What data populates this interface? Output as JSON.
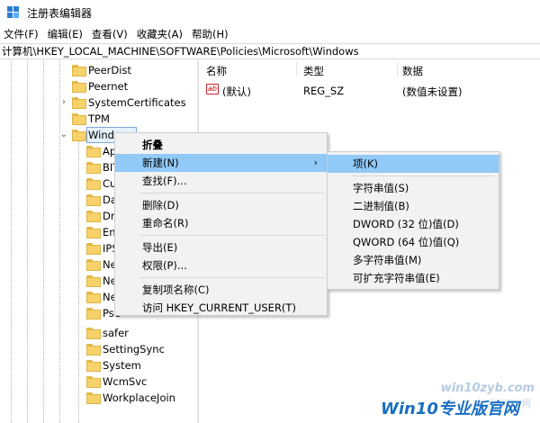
{
  "window": {
    "title": "注册表编辑器"
  },
  "menubar": [
    {
      "label": "文件(F)"
    },
    {
      "label": "编辑(E)"
    },
    {
      "label": "查看(V)"
    },
    {
      "label": "收藏夹(A)"
    },
    {
      "label": "帮助(H)"
    }
  ],
  "address": {
    "path": "计算机\\HKEY_LOCAL_MACHINE\\SOFTWARE\\Policies\\Microsoft\\Windows"
  },
  "tree": {
    "items": [
      {
        "label": "PeerDist",
        "expander": ""
      },
      {
        "label": "Peernet",
        "expander": ""
      },
      {
        "label": "SystemCertificates",
        "expander": "›"
      },
      {
        "label": "TPM",
        "expander": ""
      },
      {
        "label": "Windows",
        "expander": "⌄"
      },
      {
        "label": "Ap",
        "expander": ""
      },
      {
        "label": "BIT",
        "expander": ""
      },
      {
        "label": "Cu",
        "expander": ""
      },
      {
        "label": "Da",
        "expander": ""
      },
      {
        "label": "Dri",
        "expander": ""
      },
      {
        "label": "En",
        "expander": ""
      },
      {
        "label": "IPS",
        "expander": ""
      },
      {
        "label": "Ne",
        "expander": ""
      },
      {
        "label": "Ne",
        "expander": ""
      },
      {
        "label": "Ne",
        "expander": ""
      },
      {
        "label": "Pse",
        "expander": ""
      },
      {
        "label": "safer",
        "expander": ""
      },
      {
        "label": "SettingSync",
        "expander": ""
      },
      {
        "label": "System",
        "expander": ""
      },
      {
        "label": "WcmSvc",
        "expander": ""
      },
      {
        "label": "WorkplaceJoin",
        "expander": ""
      }
    ]
  },
  "list": {
    "headers": {
      "name": "名称",
      "type": "类型",
      "data": "数据"
    },
    "rows": [
      {
        "icon": "ab",
        "name": "(默认)",
        "type": "REG_SZ",
        "data": "(数值未设置)"
      }
    ]
  },
  "context_menu": {
    "items": [
      {
        "label": "折叠",
        "bold": true
      },
      {
        "label": "新建(N)",
        "submenu": "›"
      },
      {
        "label": "查找(F)..."
      },
      {
        "label": "删除(D)"
      },
      {
        "label": "重命名(R)"
      },
      {
        "label": "导出(E)"
      },
      {
        "label": "权限(P)..."
      },
      {
        "label": "复制项名称(C)"
      },
      {
        "label": "访问 HKEY_CURRENT_USER(T)"
      }
    ]
  },
  "submenu": {
    "items": [
      {
        "label": "项(K)"
      },
      {
        "label": "字符串值(S)"
      },
      {
        "label": "二进制值(B)"
      },
      {
        "label": "DWORD (32 位)值(D)"
      },
      {
        "label": "QWORD (64 位)值(Q)"
      },
      {
        "label": "多字符串值(M)"
      },
      {
        "label": "可扩充字符串值(E)"
      }
    ]
  },
  "watermark": {
    "site": "win10zyb.com",
    "site_sub": "系统天地网",
    "brand": "Win10专业版官网"
  },
  "colors": {
    "highlight": "#91c9f7",
    "folder": "#f7d26b",
    "brand_blue": "#1a6fc2"
  }
}
